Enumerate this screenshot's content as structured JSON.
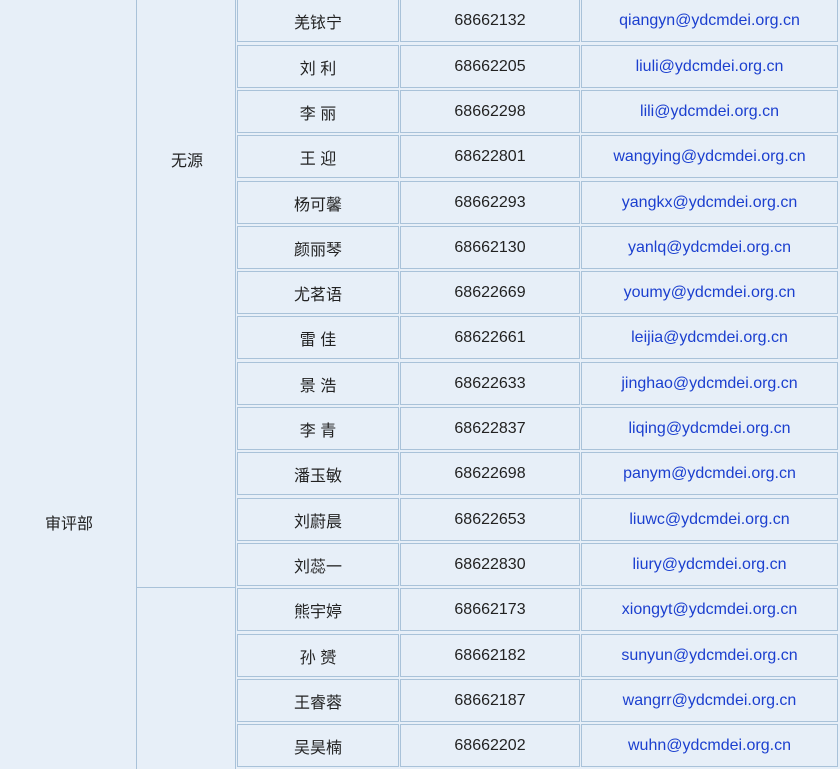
{
  "department": "审评部",
  "groups": [
    {
      "name": "无源"
    },
    {
      "name": ""
    }
  ],
  "rows": [
    {
      "name": "羌铱宁",
      "phone": "68662132",
      "email": "qiangyn@ydcmdei.org.cn"
    },
    {
      "name": "刘  利",
      "phone": "68662205",
      "email": "liuli@ydcmdei.org.cn"
    },
    {
      "name": "李  丽",
      "phone": "68662298",
      "email": "lili@ydcmdei.org.cn"
    },
    {
      "name": "王  迎",
      "phone": "68622801",
      "email": "wangying@ydcmdei.org.cn"
    },
    {
      "name": "杨可馨",
      "phone": "68662293",
      "email": "yangkx@ydcmdei.org.cn"
    },
    {
      "name": "颜丽琴",
      "phone": "68662130",
      "email": "yanlq@ydcmdei.org.cn"
    },
    {
      "name": "尤茗语",
      "phone": "68622669",
      "email": "youmy@ydcmdei.org.cn"
    },
    {
      "name": "雷  佳",
      "phone": "68622661",
      "email": "leijia@ydcmdei.org.cn"
    },
    {
      "name": "景  浩",
      "phone": "68622633",
      "email": "jinghao@ydcmdei.org.cn"
    },
    {
      "name": "李  青",
      "phone": "68622837",
      "email": "liqing@ydcmdei.org.cn"
    },
    {
      "name": "潘玉敏",
      "phone": "68622698",
      "email": "panym@ydcmdei.org.cn"
    },
    {
      "name": "刘蔚晨",
      "phone": "68622653",
      "email": "liuwc@ydcmdei.org.cn"
    },
    {
      "name": "刘蕊一",
      "phone": "68622830",
      "email": "liury@ydcmdei.org.cn"
    },
    {
      "name": "熊宇婷",
      "phone": "68662173",
      "email": "xiongyt@ydcmdei.org.cn"
    },
    {
      "name": "孙  赟",
      "phone": "68662182",
      "email": "sunyun@ydcmdei.org.cn"
    },
    {
      "name": "王睿蓉",
      "phone": "68662187",
      "email": "wangrr@ydcmdei.org.cn"
    },
    {
      "name": "吴昊楠",
      "phone": "68662202",
      "email": "wuhn@ydcmdei.org.cn"
    }
  ]
}
